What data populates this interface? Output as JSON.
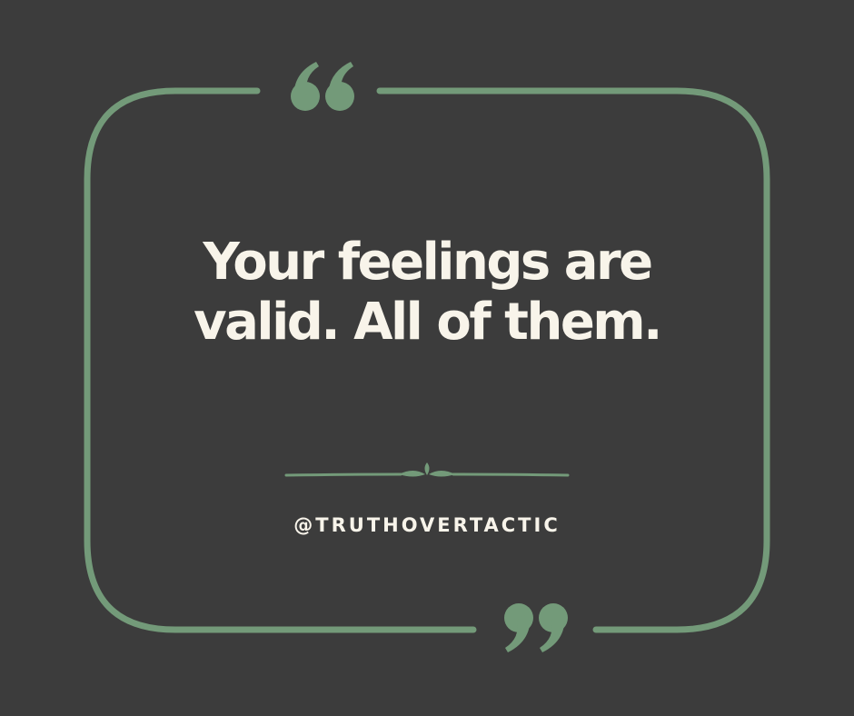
{
  "quote": {
    "line1": "Your feelings are",
    "line2": "valid. All of them."
  },
  "handle": "@TRUTHOVERTACTIC",
  "colors": {
    "background": "#3c3c3c",
    "accent": "#739a79",
    "text": "#f8f4ea"
  }
}
